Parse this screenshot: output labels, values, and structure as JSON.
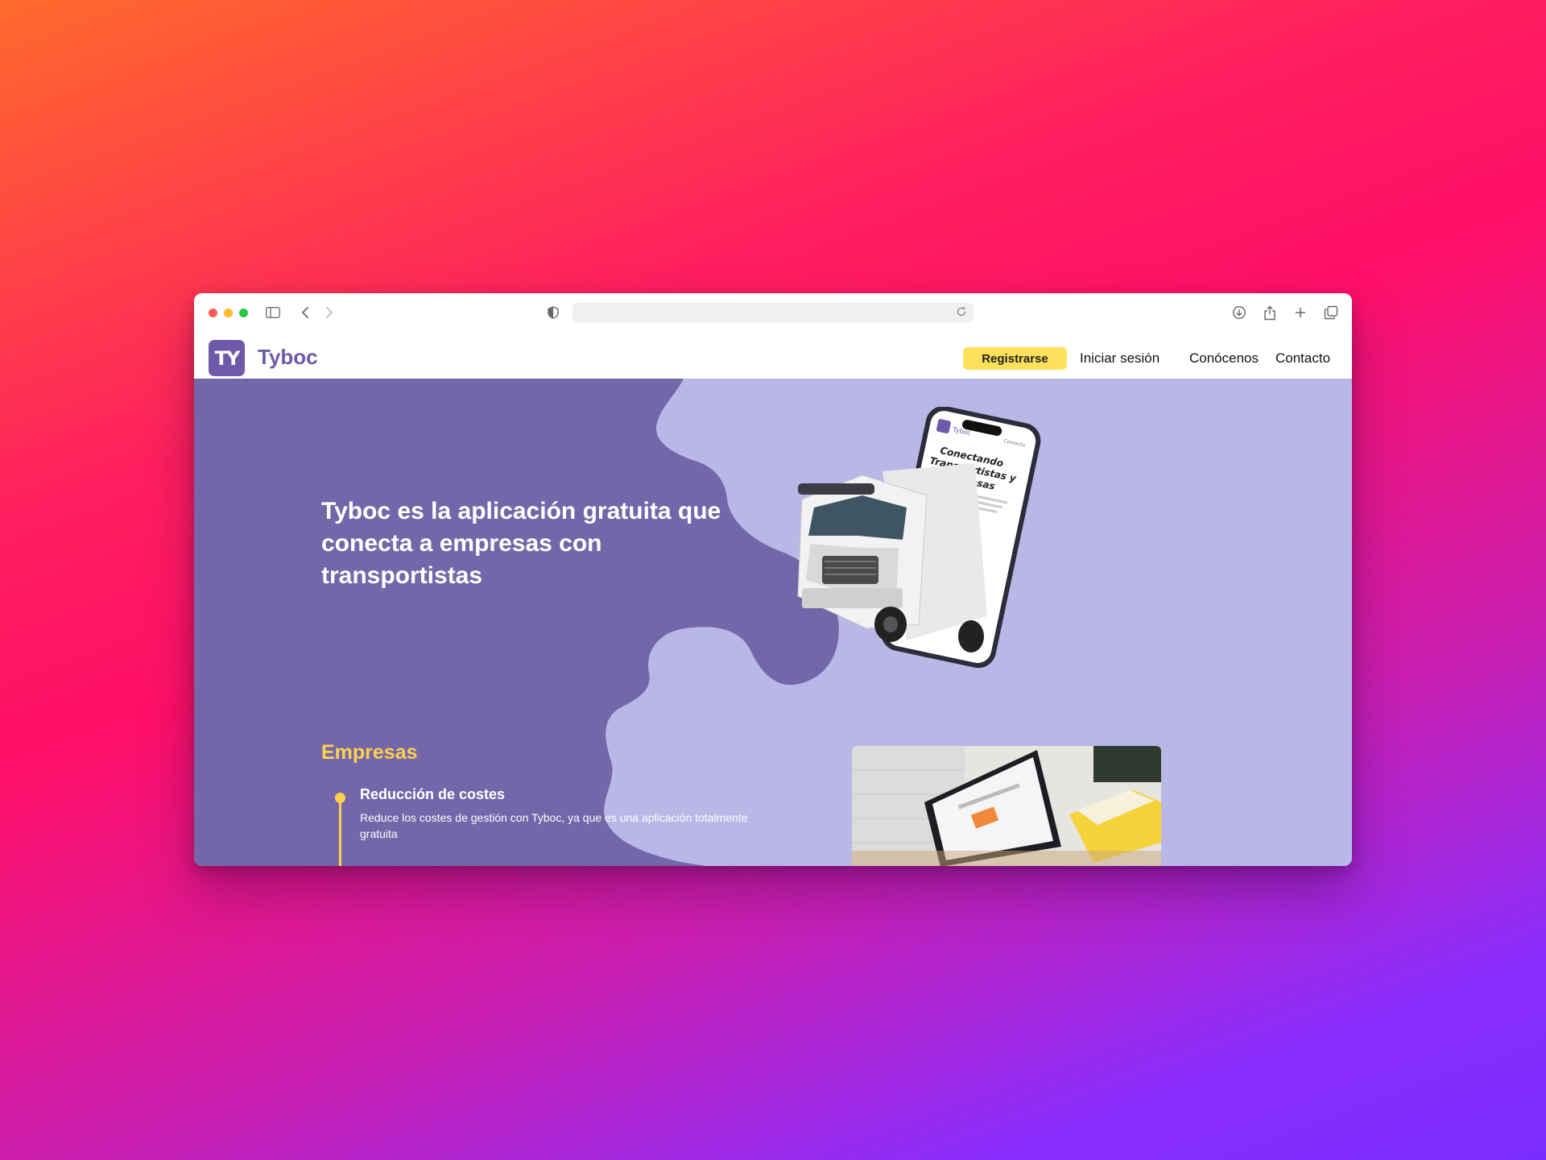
{
  "browser": {
    "url": "",
    "icons": [
      "sidebar-icon",
      "back-icon",
      "forward-icon",
      "shield-icon",
      "reload-icon",
      "download-icon",
      "share-icon",
      "new-tab-icon",
      "tabs-overview-icon"
    ]
  },
  "header": {
    "logo_text": "TY",
    "brand": "Tyboc",
    "register_label": "Registrarse",
    "login_label": "Iniciar sesión",
    "about_label": "Conócenos",
    "contact_label": "Contacto"
  },
  "hero": {
    "headline": "Tyboc es la aplicación gratuita que conecta a empresas con transportistas",
    "phone_brand": "Tyboc",
    "phone_link": "Contacto",
    "phone_headline_1": "Conectando",
    "phone_headline_2": "Transportistas y",
    "phone_headline_3": "Empresas"
  },
  "empresas": {
    "title": "Empresas",
    "items": [
      {
        "title": "Reducción de costes",
        "description": "Reduce los costes de gestión con Tyboc, ya que es una aplicación totalmente gratuita"
      }
    ]
  },
  "colors": {
    "brand_purple": "#6e5aa8",
    "hero_light": "#b9b7e6",
    "accent_yellow": "#fde15a"
  }
}
